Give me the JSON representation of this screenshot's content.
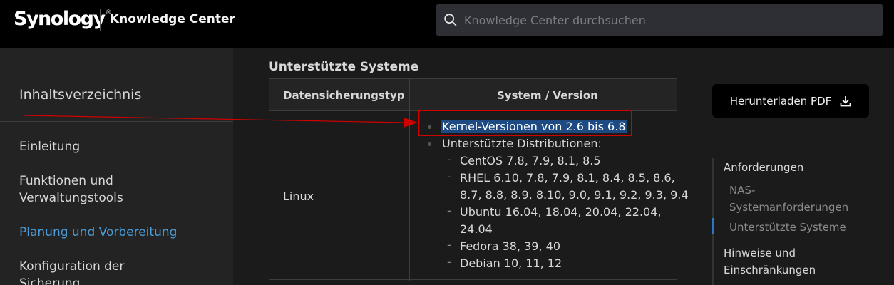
{
  "header": {
    "brand": "Synology",
    "brand_mark": "®",
    "product": "Knowledge Center",
    "search_placeholder": "Knowledge Center durchsuchen"
  },
  "sidebar": {
    "toc_title": "Inhaltsverzeichnis",
    "items": [
      {
        "label": "Einleitung"
      },
      {
        "label": "Funktionen und"
      },
      {
        "label": "Verwaltungstools"
      },
      {
        "label": "Planung und Vorbereitung"
      },
      {
        "label": "Konfiguration der"
      },
      {
        "label": "Sicherung"
      }
    ]
  },
  "content": {
    "section_title": "Unterstützte Systeme",
    "table": {
      "headers": [
        "Datensicherungstyp",
        "System / Version"
      ],
      "os": "Linux",
      "kernel": "Kernel-Versionen von 2.6 bis 6.8",
      "distros_label": "Unterstützte Distributionen:",
      "distros": [
        "CentOS 7.8, 7.9, 8.1, 8.5",
        "RHEL 6.10, 7.8, 7.9, 8.1, 8.4, 8.5, 8.6,",
        "8.7, 8.8, 8.9, 8.10, 9.0, 9.1, 9.2, 9.3, 9.4",
        "Ubuntu 16.04, 18.04, 20.04, 22.04,",
        "24.04",
        "Fedora 38, 39, 40",
        "Debian 10, 11, 12"
      ]
    }
  },
  "right_panel": {
    "pdf_button": "Herunterladen PDF",
    "toc": [
      "Anforderungen",
      "NAS-",
      "Systemanforderungen",
      "Unterstützte Systeme",
      "Hinweise und",
      "Einschränkungen"
    ]
  },
  "colors": {
    "accent": "#4a9bd6",
    "highlight": "#1d4a82",
    "annotation": "#d10000"
  }
}
